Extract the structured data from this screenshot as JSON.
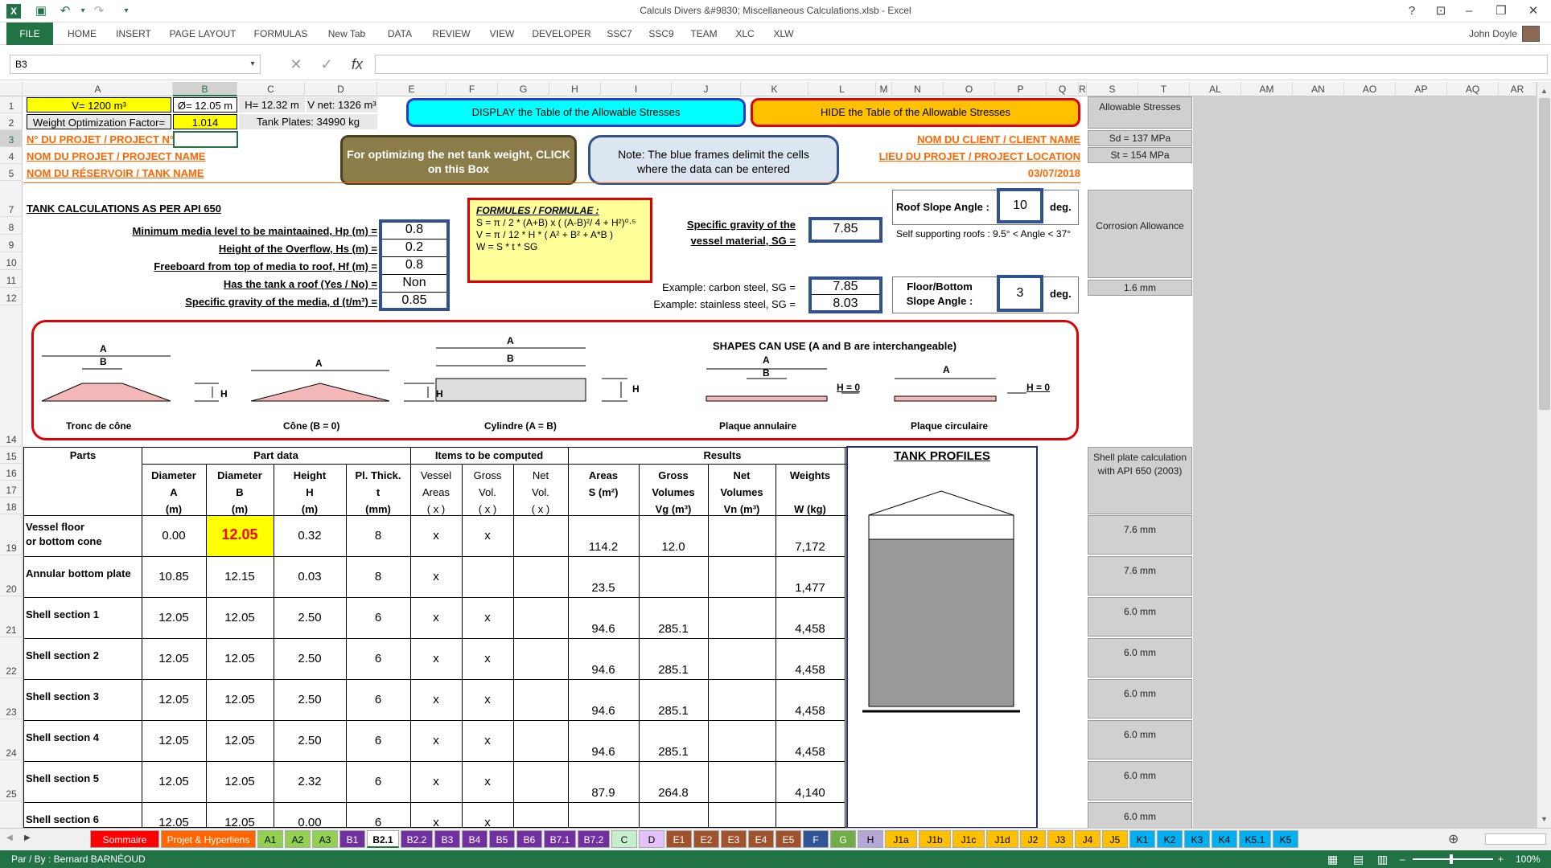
{
  "window": {
    "title": "Calculs Divers &#9830; Miscellaneous Calculations.xlsb - Excel",
    "user": "John Doyle"
  },
  "ribbon": {
    "tabs": [
      "FILE",
      "HOME",
      "INSERT",
      "PAGE LAYOUT",
      "FORMULAS",
      "New Tab",
      "DATA",
      "REVIEW",
      "VIEW",
      "DEVELOPER",
      "SSC7",
      "SSC9",
      "TEAM",
      "XLC",
      "XLW"
    ]
  },
  "formula": {
    "namebox": "B3",
    "value": ""
  },
  "columns": [
    "A",
    "B",
    "C",
    "D",
    "E",
    "F",
    "G",
    "H",
    "I",
    "J",
    "K",
    "L",
    "M",
    "N",
    "O",
    "P",
    "Q",
    "R",
    "S",
    "T",
    "AL",
    "AM",
    "AN",
    "AO",
    "AP",
    "AQ",
    "AR"
  ],
  "rows": [
    "1",
    "2",
    "3",
    "4",
    "5",
    "7",
    "8",
    "9",
    "10",
    "11",
    "12",
    "14",
    "15",
    "16",
    "17",
    "18",
    "19",
    "20",
    "21",
    "22",
    "23",
    "24",
    "25"
  ],
  "top": {
    "v": "V= 1200 m³",
    "dia": "Ø= 12.05 m",
    "h": "H= 12.32 m",
    "vnet": "V net: 1326 m³",
    "wof_label": "Weight Optimization Factor=",
    "wof": "1.014",
    "plates": "Tank Plates: 34990 kg",
    "proj_no": "N° DU PROJET / PROJECT N°",
    "proj_name": "NOM DU PROJET / PROJECT NAME",
    "tank_name": "NOM DU RÉSERVOIR / TANK NAME",
    "client": "NOM DU CLIENT / CLIENT NAME",
    "location": "LIEU DU PROJET / PROJECT LOCATION",
    "date": "03/07/2018",
    "btn_display": "DISPLAY the Table of the Allowable Stresses",
    "btn_hide": "HIDE the Table of the Allowable Stresses",
    "optimize": "For optimizing the net tank weight, CLICK on this Box",
    "note": "Note: The blue frames delimit the cells where the data can be entered"
  },
  "allow": {
    "title": "Allowable Stresses",
    "sd": "Sd =  137  MPa",
    "st": "St =  154  MPa",
    "corr": "Corrosion Allowance",
    "corr_val": "1.6 mm"
  },
  "params": {
    "title": "TANK CALCULATIONS AS PER API 650",
    "hp_label": "Minimum media level to be maintaained, Hp (m) =",
    "hp": "0.8",
    "hs_label": "Height of the Overflow, Hs (m) =",
    "hs": "0.2",
    "hf_label": "Freeboard from top of media to roof, Hf (m) =",
    "hf": "0.8",
    "roof_label": "Has the tank a roof (Yes / No) =",
    "roof": "Non",
    "d_label": "Specific gravity of the media, d (t/m³) =",
    "d": "0.85",
    "formula_title": "FORMULES / FORMULAE :",
    "f1": "S = π / 2 * (A+B) x ( (A-B)²/ 4 + H²)⁰·⁵",
    "f2": "V = π / 12 * H * ( A² + B² + A*B )",
    "f3": "W = S * t * SG",
    "sg_label": "Specific gravity of the vessel material, SG =",
    "sg": "7.85",
    "cs_label": "Example: carbon steel, SG =",
    "cs": "7.85",
    "ss_label": "Example: stainless steel, SG =",
    "ss": "8.03",
    "roof_angle_label": "Roof Slope Angle :",
    "roof_angle": "10",
    "deg": "deg.",
    "self_sup": "Self supporting roofs : 9.5° < Angle < 37°",
    "floor_label": "Floor/Bottom Slope Angle :",
    "floor_angle": "3"
  },
  "shapes": {
    "title": "SHAPES CAN USE (A and B are interchangeable)",
    "s1": "Tronc de cône",
    "s2": "Cône (B = 0)",
    "s3": "Cylindre (A = B)",
    "s4": "Plaque annulaire",
    "s5": "Plaque circulaire",
    "a": "A",
    "b": "B",
    "h": "H",
    "h0": "H = 0"
  },
  "table": {
    "parts": "Parts",
    "partdata": "Part data",
    "items": "Items to be computed",
    "results": "Results",
    "h_diaA": [
      "Diameter",
      "A",
      "(m)"
    ],
    "h_diaB": [
      "Diameter",
      "B",
      "(m)"
    ],
    "h_height": [
      "Height",
      "H",
      "(m)"
    ],
    "h_thick": [
      "Pl. Thick.",
      "t",
      "(mm)"
    ],
    "h_va": [
      "Vessel",
      "Areas",
      "( x )"
    ],
    "h_gv": [
      "Gross",
      "Vol.",
      "( x )"
    ],
    "h_nv": [
      "Net",
      "Vol.",
      "( x )"
    ],
    "h_area": [
      "Areas",
      "",
      "S (m²)"
    ],
    "h_gvol": [
      "Gross",
      "Volumes",
      "Vg (m³)"
    ],
    "h_nvol": [
      "Net",
      "Volumes",
      "Vn (m³)"
    ],
    "h_w": [
      "Weights",
      "",
      "W (kg)"
    ],
    "rows": [
      {
        "name": "Vessel floor",
        "name2": "or bottom cone",
        "a": "0.00",
        "b": "12.05",
        "h": "0.32",
        "t": "8",
        "va": "x",
        "gv": "x",
        "nv": "",
        "s": "114.2",
        "vg": "12.0",
        "vn": "",
        "w": "7,172",
        "shell": "7.6 mm"
      },
      {
        "name": "Annular bottom plate",
        "name2": "",
        "a": "10.85",
        "b": "12.15",
        "h": "0.03",
        "t": "8",
        "va": "x",
        "gv": "",
        "nv": "",
        "s": "23.5",
        "vg": "",
        "vn": "",
        "w": "1,477",
        "shell": "7.6 mm"
      },
      {
        "name": "Shell section 1",
        "name2": "",
        "a": "12.05",
        "b": "12.05",
        "h": "2.50",
        "t": "6",
        "va": "x",
        "gv": "x",
        "nv": "",
        "s": "94.6",
        "vg": "285.1",
        "vn": "",
        "w": "4,458",
        "shell": "6.0 mm"
      },
      {
        "name": "Shell section 2",
        "name2": "",
        "a": "12.05",
        "b": "12.05",
        "h": "2.50",
        "t": "6",
        "va": "x",
        "gv": "x",
        "nv": "",
        "s": "94.6",
        "vg": "285.1",
        "vn": "",
        "w": "4,458",
        "shell": "6.0 mm"
      },
      {
        "name": "Shell section 3",
        "name2": "",
        "a": "12.05",
        "b": "12.05",
        "h": "2.50",
        "t": "6",
        "va": "x",
        "gv": "x",
        "nv": "",
        "s": "94.6",
        "vg": "285.1",
        "vn": "",
        "w": "4,458",
        "shell": "6.0 mm"
      },
      {
        "name": "Shell section 4",
        "name2": "",
        "a": "12.05",
        "b": "12.05",
        "h": "2.50",
        "t": "6",
        "va": "x",
        "gv": "x",
        "nv": "",
        "s": "94.6",
        "vg": "285.1",
        "vn": "",
        "w": "4,458",
        "shell": "6.0 mm"
      },
      {
        "name": "Shell section 5",
        "name2": "",
        "a": "12.05",
        "b": "12.05",
        "h": "2.32",
        "t": "6",
        "va": "x",
        "gv": "x",
        "nv": "",
        "s": "87.9",
        "vg": "264.8",
        "vn": "",
        "w": "4,140",
        "shell": "6.0 mm"
      },
      {
        "name": "Shell section 6",
        "name2": "",
        "a": "12.05",
        "b": "12.05",
        "h": "0.00",
        "t": "6",
        "va": "x",
        "gv": "x",
        "nv": "",
        "s": "",
        "vg": "",
        "vn": "",
        "w": "",
        "shell": "6.0 mm"
      }
    ],
    "profiles": "TANK PROFILES",
    "shell_calc": "Shell plate calculation with API 650 (2003)"
  },
  "sheet_tabs": [
    {
      "label": "Sommaire",
      "color": "#ff0000",
      "fg": "#fff"
    },
    {
      "label": "Projet & Hyperliens",
      "color": "#ff6600",
      "fg": "#fff"
    },
    {
      "label": "A1",
      "color": "#92d050",
      "fg": "#000"
    },
    {
      "label": "A2",
      "color": "#92d050",
      "fg": "#000"
    },
    {
      "label": "A3",
      "color": "#92d050",
      "fg": "#000"
    },
    {
      "label": "B1",
      "color": "#7030a0",
      "fg": "#fff"
    },
    {
      "label": "B2.1",
      "color": "#ffffff",
      "fg": "#000"
    },
    {
      "label": "B2.2",
      "color": "#7030a0",
      "fg": "#fff"
    },
    {
      "label": "B3",
      "color": "#7030a0",
      "fg": "#fff"
    },
    {
      "label": "B4",
      "color": "#7030a0",
      "fg": "#fff"
    },
    {
      "label": "B5",
      "color": "#7030a0",
      "fg": "#fff"
    },
    {
      "label": "B6",
      "color": "#7030a0",
      "fg": "#fff"
    },
    {
      "label": "B7.1",
      "color": "#7030a0",
      "fg": "#fff"
    },
    {
      "label": "B7.2",
      "color": "#7030a0",
      "fg": "#fff"
    },
    {
      "label": "C",
      "color": "#c6efce",
      "fg": "#000"
    },
    {
      "label": "D",
      "color": "#e4c1f9",
      "fg": "#000"
    },
    {
      "label": "E1",
      "color": "#a0522d",
      "fg": "#fff"
    },
    {
      "label": "E2",
      "color": "#a0522d",
      "fg": "#fff"
    },
    {
      "label": "E3",
      "color": "#a0522d",
      "fg": "#fff"
    },
    {
      "label": "E4",
      "color": "#a0522d",
      "fg": "#fff"
    },
    {
      "label": "E5",
      "color": "#a0522d",
      "fg": "#fff"
    },
    {
      "label": "F",
      "color": "#2f5597",
      "fg": "#fff"
    },
    {
      "label": "G",
      "color": "#70ad47",
      "fg": "#fff"
    },
    {
      "label": "H",
      "color": "#b4a7d6",
      "fg": "#000"
    },
    {
      "label": "J1a",
      "color": "#ffc000",
      "fg": "#000"
    },
    {
      "label": "J1b",
      "color": "#ffc000",
      "fg": "#000"
    },
    {
      "label": "J1c",
      "color": "#ffc000",
      "fg": "#000"
    },
    {
      "label": "J1d",
      "color": "#ffc000",
      "fg": "#000"
    },
    {
      "label": "J2",
      "color": "#ffc000",
      "fg": "#000"
    },
    {
      "label": "J3",
      "color": "#ffc000",
      "fg": "#000"
    },
    {
      "label": "J4",
      "color": "#ffc000",
      "fg": "#000"
    },
    {
      "label": "J5",
      "color": "#ffc000",
      "fg": "#000"
    },
    {
      "label": "K1",
      "color": "#00b0f0",
      "fg": "#000"
    },
    {
      "label": "K2",
      "color": "#00b0f0",
      "fg": "#000"
    },
    {
      "label": "K3",
      "color": "#00b0f0",
      "fg": "#000"
    },
    {
      "label": "K4",
      "color": "#00b0f0",
      "fg": "#000"
    },
    {
      "label": "K5.1",
      "color": "#00b0f0",
      "fg": "#000"
    },
    {
      "label": "K5",
      "color": "#00b0f0",
      "fg": "#000"
    }
  ],
  "status": {
    "left": "Par / By : Bernard BARNÉOUD",
    "zoom": "100%"
  }
}
